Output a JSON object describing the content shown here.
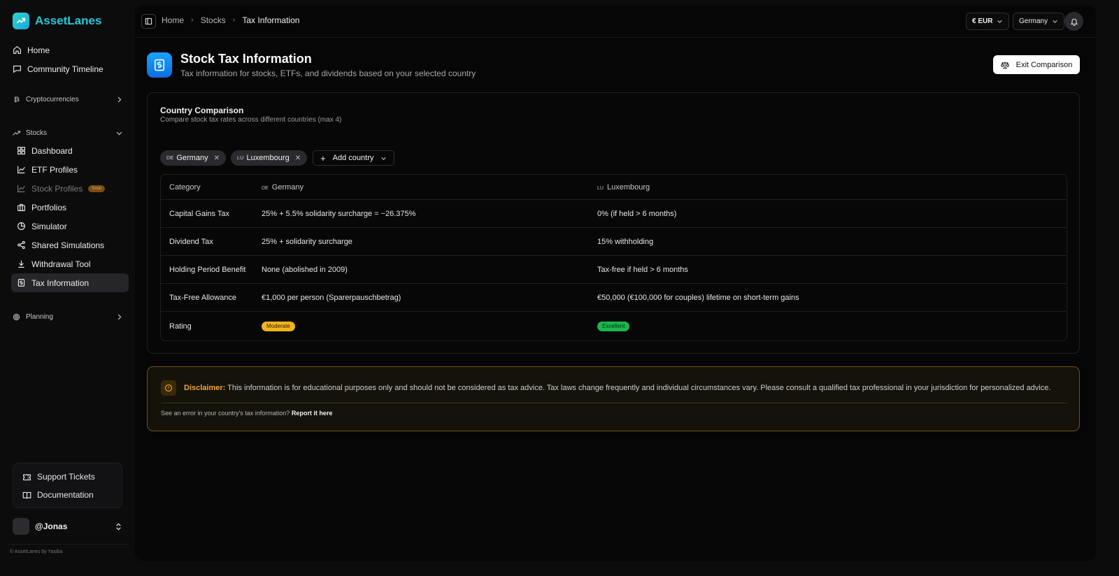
{
  "brand": {
    "name": "AssetLanes"
  },
  "sidebar": {
    "home": "Home",
    "community": "Community Timeline",
    "crypto_section": "Cryptocurrencies",
    "stocks_section": "Stocks",
    "stocks_items": [
      {
        "label": "Dashboard"
      },
      {
        "label": "ETF Profiles"
      },
      {
        "label": "Stock Profiles",
        "badge": "Soon"
      },
      {
        "label": "Portfolios"
      },
      {
        "label": "Simulator"
      },
      {
        "label": "Shared Simulations"
      },
      {
        "label": "Withdrawal Tool"
      },
      {
        "label": "Tax Information"
      }
    ],
    "planning_section": "Planning",
    "support_tickets": "Support Tickets",
    "documentation": "Documentation",
    "user": "@Jonas",
    "footer": "© AssetLanes by Yasiba"
  },
  "topbar": {
    "breadcrumb": [
      "Home",
      "Stocks",
      "Tax Information"
    ],
    "currency": "€ EUR",
    "country": "Germany"
  },
  "page": {
    "title": "Stock Tax Information",
    "subtitle": "Tax information for stocks, ETFs, and dividends based on your selected country",
    "exit_button": "Exit Comparison"
  },
  "comparison": {
    "title": "Country Comparison",
    "subtitle": "Compare stock tax rates across different countries (max 4)",
    "chips": [
      {
        "code": "DE",
        "name": "Germany"
      },
      {
        "code": "LU",
        "name": "Luxembourg"
      }
    ],
    "add_label": "Add country",
    "table": {
      "header": {
        "category": "Category",
        "col1_code": "DE",
        "col1": "Germany",
        "col2_code": "LU",
        "col2": "Luxembourg"
      },
      "rows": [
        {
          "category": "Capital Gains Tax",
          "de": "25% + 5.5% solidarity surcharge = ~26.375%",
          "lu": "0% (if held > 6 months)"
        },
        {
          "category": "Dividend Tax",
          "de": "25% + solidarity surcharge",
          "lu": "15% withholding"
        },
        {
          "category": "Holding Period Benefit",
          "de": "None (abolished in 2009)",
          "lu": "Tax-free if held > 6 months"
        },
        {
          "category": "Tax-Free Allowance",
          "de": "€1,000 per person (Sparerpauschbetrag)",
          "lu": "€50,000 (€100,000 for couples) lifetime on short-term gains"
        },
        {
          "category": "Rating",
          "de": "Moderate",
          "lu": "Excellent"
        }
      ]
    }
  },
  "disclaimer": {
    "label": "Disclaimer:",
    "text": "This information is for educational purposes only and should not be considered as tax advice. Tax laws change frequently and individual circumstances vary. Please consult a qualified tax professional in your jurisdiction for personalized advice.",
    "foot": "See an error in your country's tax information?",
    "link": "Report it here"
  },
  "colors": {
    "accent": "#27c8d6",
    "moderate": "#f2b41c",
    "excellent": "#18b84a",
    "warning": "#f0a43a"
  }
}
